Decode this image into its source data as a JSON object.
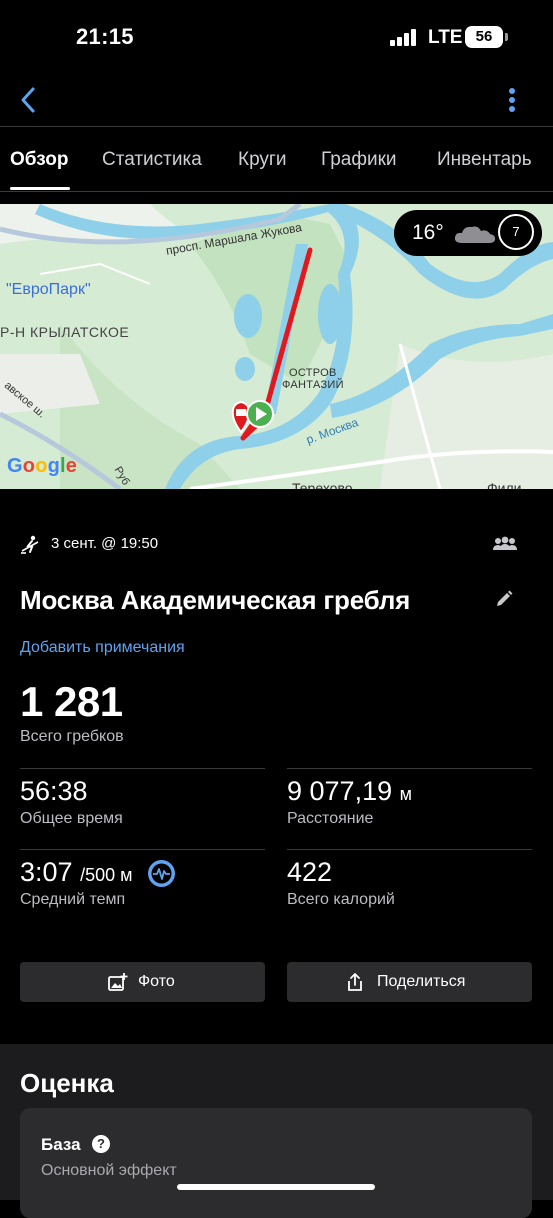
{
  "status_bar": {
    "time": "21:15",
    "network": "LTE",
    "battery": "56"
  },
  "tabs": [
    {
      "label": "Обзор",
      "active": true
    },
    {
      "label": "Статистика",
      "active": false
    },
    {
      "label": "Круги",
      "active": false
    },
    {
      "label": "Графики",
      "active": false
    },
    {
      "label": "Инвентарь",
      "active": false
    }
  ],
  "map": {
    "labels": {
      "street_marshal": "просп. Маршала Жукова",
      "europark": "\"ЕвроПарк\"",
      "krylatskoe": "Р-Н КРЫЛАТСКОЕ",
      "island_1": "ОСТРОВ",
      "island_2": "ФАНТАЗИЙ",
      "river": "р. Москва",
      "street_slavyansky": "авское ш.",
      "terekhovo": "Терехово",
      "fili": "Фили",
      "rub": "Руб"
    },
    "weather": {
      "temperature": "16°",
      "icon": "cloud-icon",
      "wind_speed": "7"
    },
    "attribution": "Google"
  },
  "activity": {
    "type_icon": "rowing-icon",
    "date": "3 сент. @ 19:50",
    "title": "Москва Академическая гребля",
    "add_note": "Добавить примечания"
  },
  "summary": {
    "value": "1 281",
    "label": "Всего гребков"
  },
  "stats": [
    {
      "value": "56:38",
      "unit": "",
      "label": "Общее время"
    },
    {
      "value": "9 077,19",
      "unit": "м",
      "label": "Расстояние"
    },
    {
      "value": "3:07",
      "unit": "/500 м",
      "label": "Средний темп"
    },
    {
      "value": "422",
      "unit": "",
      "label": "Всего калорий"
    }
  ],
  "actions": {
    "photo": "Фото",
    "share": "Поделиться"
  },
  "evaluation": {
    "title": "Оценка",
    "card_title": "База",
    "card_subtitle": "Основной эффект"
  },
  "colors": {
    "accent": "#5fa3f0",
    "route": "#e0191f",
    "start_marker": "#4caf50"
  }
}
